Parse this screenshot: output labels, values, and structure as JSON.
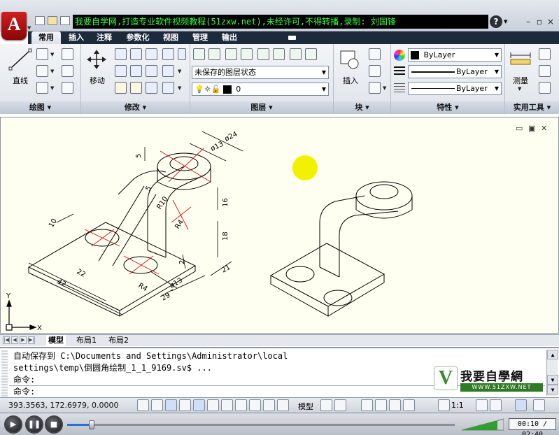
{
  "title_bar": {
    "watermark": "我要自学网,打造专业软件视频教程(51zxw.net),未经许可,不得转播,录制: 刘国锋",
    "app_letter": "A",
    "help": "?",
    "minimize": "–",
    "restore": "▫",
    "close": "×"
  },
  "ribbon_tabs": [
    "常用",
    "插入",
    "注释",
    "参数化",
    "视图",
    "管理",
    "输出"
  ],
  "ribbon_active_tab": "常用",
  "panels": {
    "draw": {
      "title": "绘图 ▾",
      "line_label": "直线"
    },
    "modify": {
      "title": "修改 ▾",
      "move_label": "移动"
    },
    "layers": {
      "title": "图层 ▾",
      "layer_state": "未保存的图层状态",
      "current_layer": "0"
    },
    "block": {
      "title": "块 ▾",
      "insert_label": "插入"
    },
    "properties": {
      "title": "特性 ▾",
      "color": "ByLayer",
      "linetype": "ByLayer",
      "lineweight": "ByLayer"
    },
    "utilities": {
      "title": "实用工具 ▾",
      "measure_label": "测量"
    }
  },
  "drawing_dims": [
    "ø24",
    "ø13",
    "5",
    "5",
    "R10",
    "R4",
    "16",
    "18",
    "10",
    "22",
    "42",
    "R4",
    "2",
    "ø13",
    "29",
    "21"
  ],
  "ucs": {
    "x": "X",
    "y": "Y"
  },
  "layout_tabs": [
    "模型",
    "布局1",
    "布局2"
  ],
  "active_layout": "模型",
  "command_window": {
    "lines": [
      "自动保存到 C:\\Documents and Settings\\Administrator\\local",
      "settings\\temp\\倒圆角绘制_1_1_9169.sv$ ...",
      "命令:",
      "命令:"
    ],
    "logo_text": "我要自學網",
    "logo_url": "WWW.51ZXW.NET"
  },
  "status_bar": {
    "coordinates": "393.3563, 172.6979, 0.0000",
    "model_label": "模型",
    "scale": "1:1"
  },
  "player": {
    "time": "00:10 / 02:40",
    "progress_fraction": 0.0625,
    "volume_fraction": 0.85
  },
  "colors": {
    "canvas_bg": "#fffff1",
    "watermark_text": "#3cff3c",
    "centerline": "#e01010",
    "highlight": "#f2f200"
  }
}
